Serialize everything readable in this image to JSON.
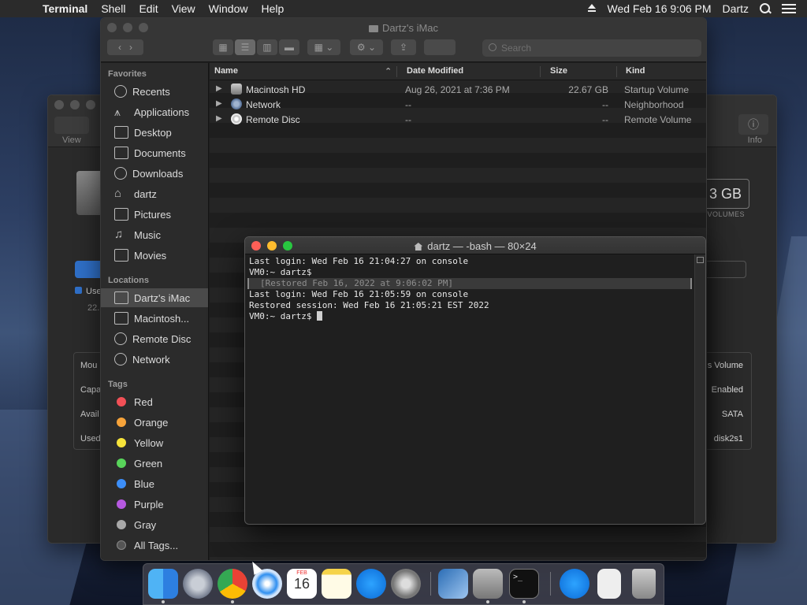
{
  "menubar": {
    "app_name": "Terminal",
    "items": [
      "Shell",
      "Edit",
      "View",
      "Window",
      "Help"
    ],
    "datetime": "Wed Feb 16  9:06 PM",
    "user": "Dartz"
  },
  "disk_utility": {
    "view_label": "View",
    "info_label": "Info",
    "capacity_fragment": "3 GB",
    "volumes_fragment": "VOLUMES",
    "used_fragment": "Use",
    "used_value_fragment": "22.",
    "info_left": [
      "Mou",
      "Capa",
      "Avail",
      "Used"
    ],
    "info_right": [
      "s Volume",
      "Enabled",
      "SATA",
      "disk2s1"
    ]
  },
  "finder": {
    "title": "Dartz's iMac",
    "search_placeholder": "Search",
    "sidebar": {
      "favorites_header": "Favorites",
      "favorites": [
        "Recents",
        "Applications",
        "Desktop",
        "Documents",
        "Downloads",
        "dartz",
        "Pictures",
        "Music",
        "Movies"
      ],
      "locations_header": "Locations",
      "locations": [
        "Dartz's iMac",
        "Macintosh...",
        "Remote Disc",
        "Network"
      ],
      "tags_header": "Tags",
      "tags": [
        {
          "label": "Red",
          "color": "#f25056"
        },
        {
          "label": "Orange",
          "color": "#f6a33a"
        },
        {
          "label": "Yellow",
          "color": "#f6e33a"
        },
        {
          "label": "Green",
          "color": "#58d45a"
        },
        {
          "label": "Blue",
          "color": "#3c8ef8"
        },
        {
          "label": "Purple",
          "color": "#b659e0"
        },
        {
          "label": "Gray",
          "color": "#a8a8a8"
        }
      ],
      "all_tags": "All Tags..."
    },
    "columns": {
      "name": "Name",
      "date": "Date Modified",
      "size": "Size",
      "kind": "Kind"
    },
    "rows": [
      {
        "name": "Macintosh HD",
        "date": "Aug 26, 2021 at 7:36 PM",
        "size": "22.67 GB",
        "kind": "Startup Volume"
      },
      {
        "name": "Network",
        "date": "--",
        "size": "--",
        "kind": "Neighborhood"
      },
      {
        "name": "Remote Disc",
        "date": "--",
        "size": "--",
        "kind": "Remote Volume"
      }
    ]
  },
  "terminal": {
    "title": "dartz — -bash — 80×24",
    "lines": [
      "Last login: Wed Feb 16 21:04:27 on console",
      "VM0:~ dartz$",
      "[Restored Feb 16, 2022 at 9:06:02 PM]",
      "Last login: Wed Feb 16 21:05:59 on console",
      "Restored session: Wed Feb 16 21:05:21 EST 2022",
      "VM0:~ dartz$ "
    ]
  },
  "dock": {
    "apps": [
      "Finder",
      "Launchpad",
      "Google Chrome",
      "Safari",
      "Calendar",
      "Notes",
      "App Store",
      "System Preferences",
      "VirtualBox",
      "Disk Utility",
      "Terminal",
      "App Store Downloads",
      "Documents",
      "Trash"
    ],
    "calendar_month": "FEB",
    "calendar_day": "16"
  }
}
